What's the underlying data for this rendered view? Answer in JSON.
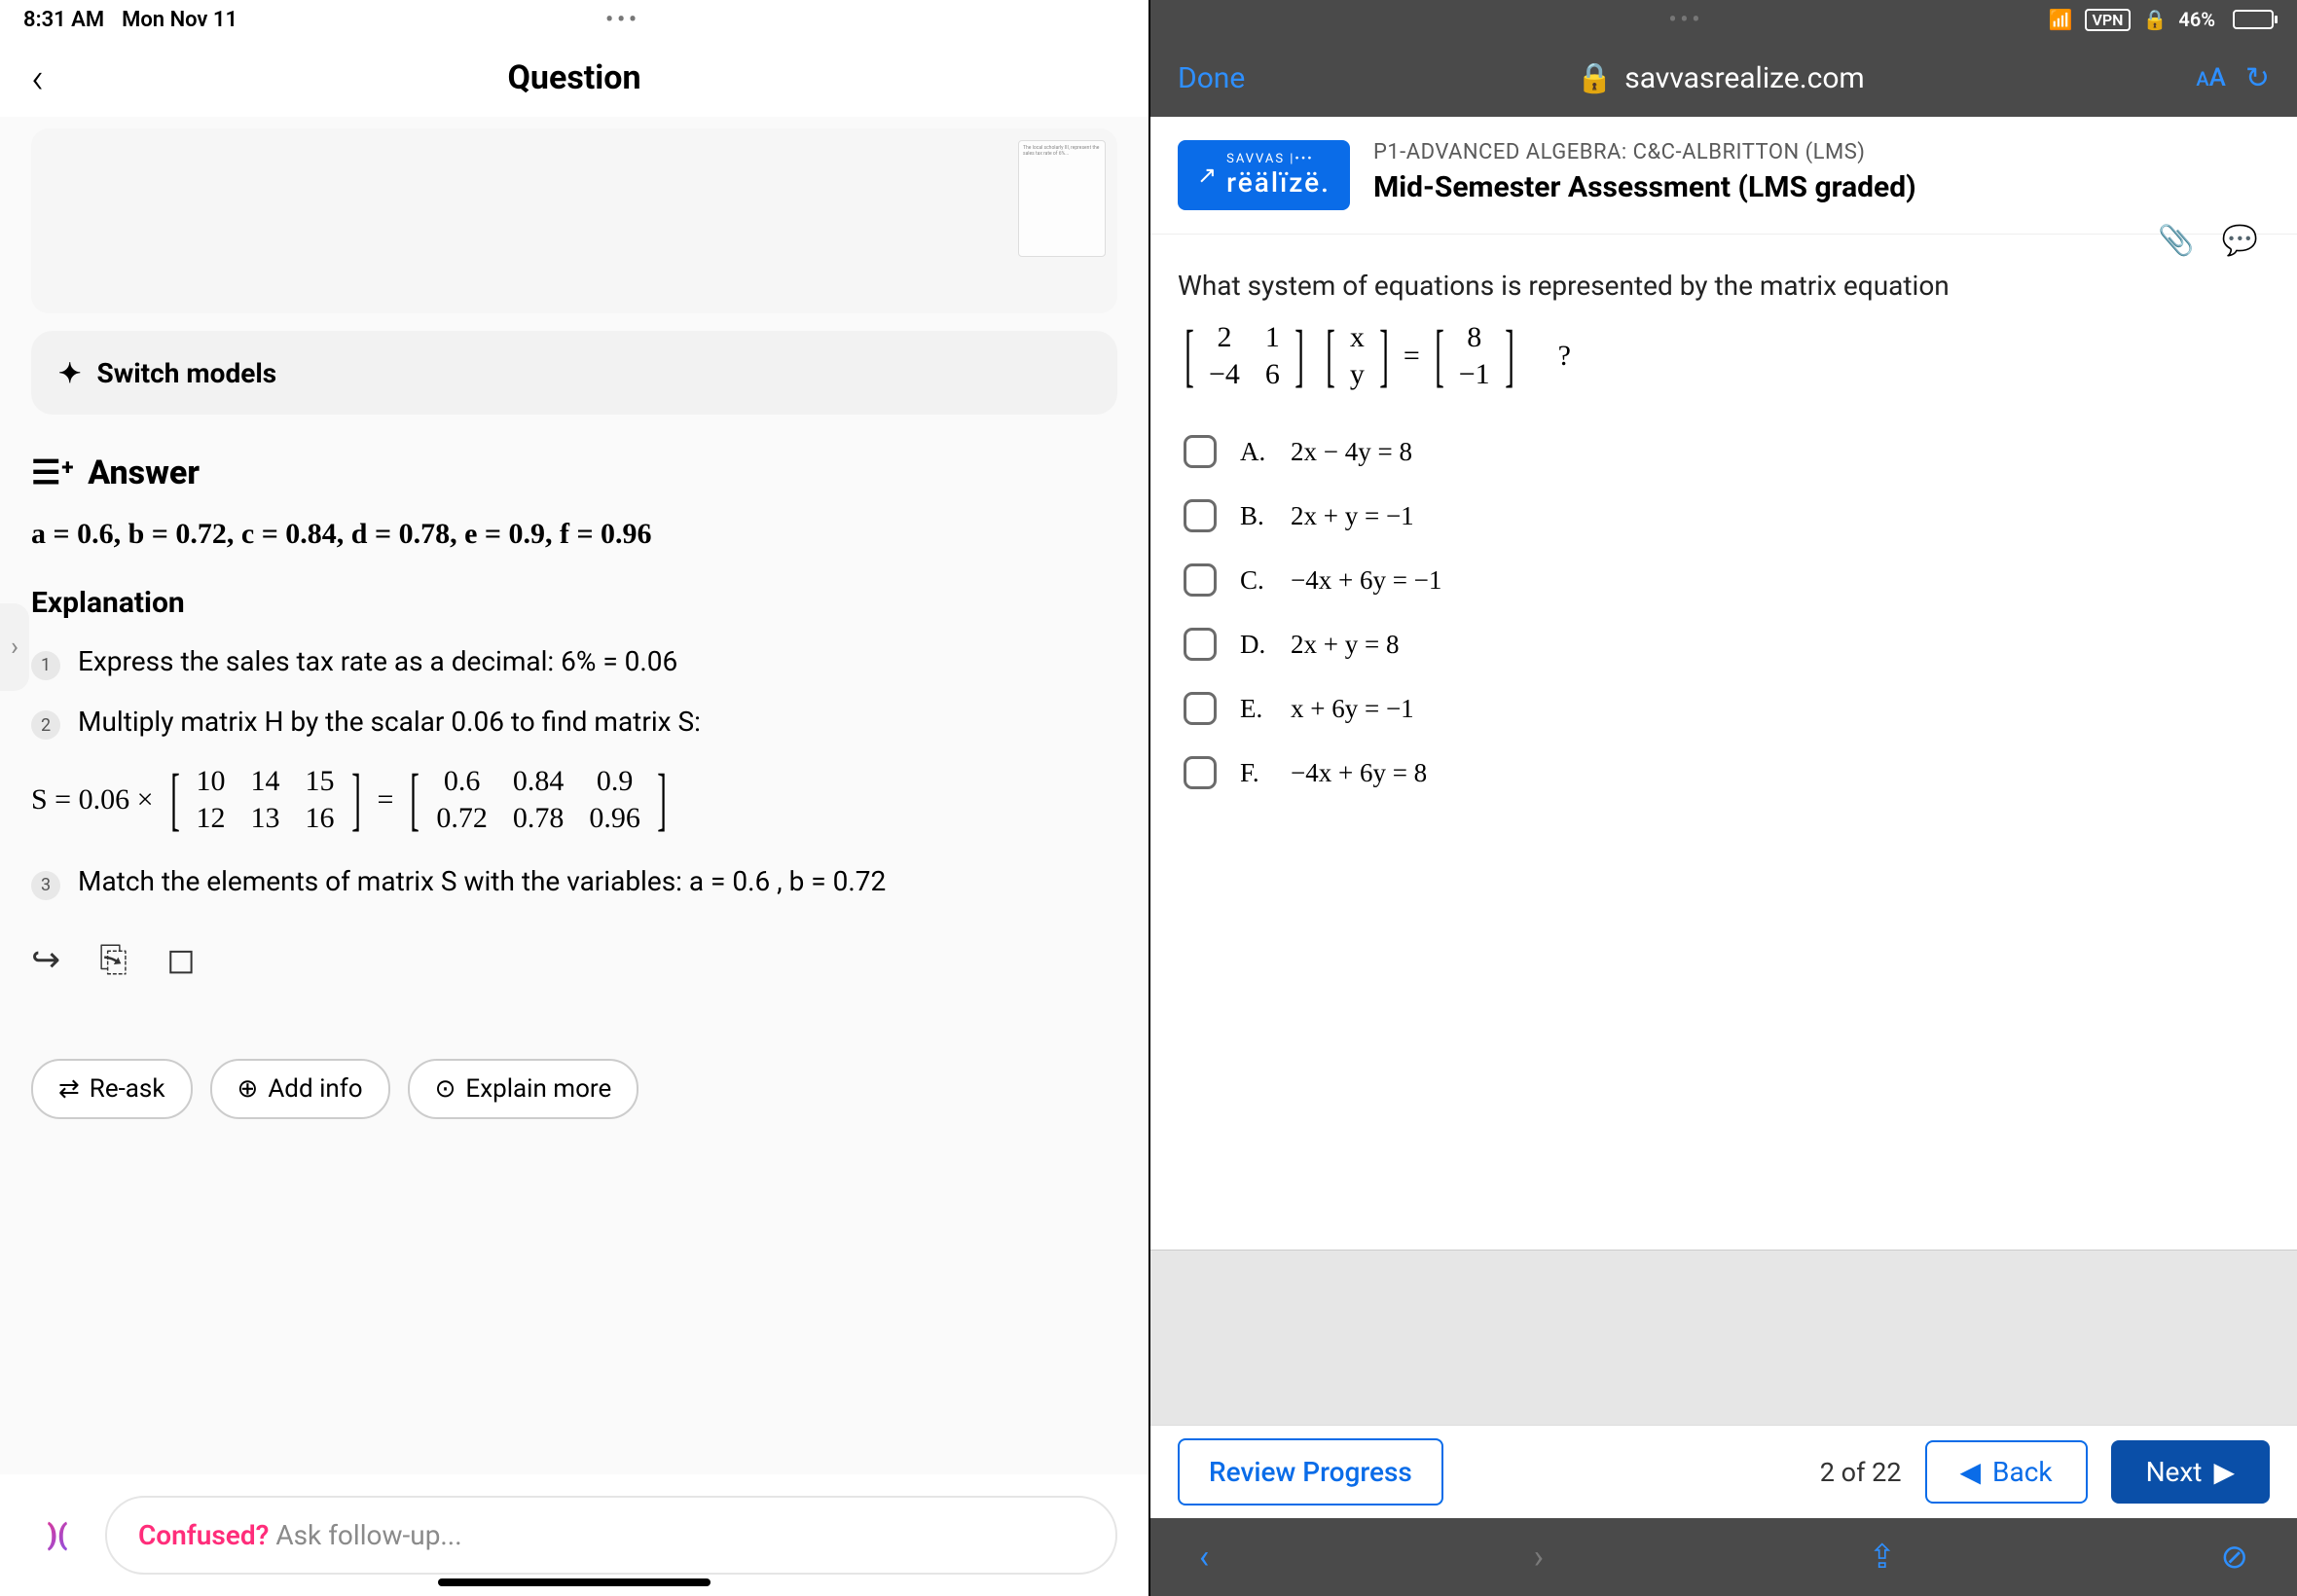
{
  "status": {
    "time": "8:31 AM",
    "date": "Mon Nov 11",
    "vpn": "VPN",
    "battery_pct": "46%"
  },
  "left": {
    "title": "Question",
    "switch_models": "Switch models",
    "answer_heading": "Answer",
    "answer_line": "a = 0.6, b = 0.72, c = 0.84, d = 0.78, e = 0.9, f = 0.96",
    "explanation_heading": "Explanation",
    "steps": {
      "s1": "Express the sales tax rate as a decimal: 6% = 0.06",
      "s2": "Multiply matrix H by the scalar 0.06 to find matrix S:",
      "s3": "Match the elements of matrix S with the variables:  a = 0.6 ,  b = 0.72"
    },
    "matrixEq": {
      "lhs_prefix": "S = 0.06 ×",
      "m1": [
        "10",
        "12",
        "14",
        "13",
        "15",
        "16"
      ],
      "eq": "=",
      "m2": [
        "0.6",
        "0.72",
        "0.84",
        "0.78",
        "0.9",
        "0.96"
      ]
    },
    "chips": {
      "reask": "Re-ask",
      "addinfo": "Add info",
      "explain": "Explain more"
    },
    "followup_confused": "Confused? ",
    "followup_ask": "Ask follow-up..."
  },
  "right": {
    "done": "Done",
    "url": "savvasrealize.com",
    "aa": "AA",
    "badge_small": "SAVVAS |•••",
    "badge_big": "rëälïzë.",
    "crumb": "P1-ADVANCED ALGEBRA: C&C-ALBRITTON (LMS)",
    "title": "Mid-Semester Assessment (LMS graded)",
    "question": "What system of equations is represented by the matrix equation",
    "matrix": {
      "a": [
        "2",
        "−4",
        "1",
        "6"
      ],
      "xy": [
        "x",
        "y"
      ],
      "eq": "=",
      "b": [
        "8",
        "−1"
      ],
      "q": "?"
    },
    "choices": [
      {
        "letter": "A.",
        "text": "2x − 4y = 8"
      },
      {
        "letter": "B.",
        "text": "2x + y = −1"
      },
      {
        "letter": "C.",
        "text": "−4x + 6y = −1"
      },
      {
        "letter": "D.",
        "text": "2x + y = 8"
      },
      {
        "letter": "E.",
        "text": "x + 6y = −1"
      },
      {
        "letter": "F.",
        "text": "−4x + 6y = 8"
      }
    ],
    "review": "Review Progress",
    "counter": "2 of 22",
    "back": "Back",
    "next": "Next"
  }
}
